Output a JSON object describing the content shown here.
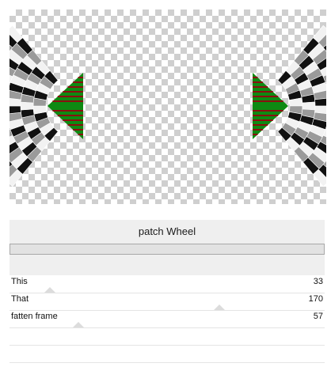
{
  "panel": {
    "title": "patch Wheel"
  },
  "sliders": [
    {
      "label": "This",
      "value": "33",
      "level": 0.13
    },
    {
      "label": "That",
      "value": "170",
      "level": 0.66
    },
    {
      "label": "fatten frame",
      "value": "57",
      "level": 0.22
    }
  ],
  "preview": {
    "colors": {
      "green": "#0e8a12",
      "red": "#8a1010",
      "dark": "#111111",
      "light": "#f2f2f2",
      "gray": "#9a9a9a"
    }
  }
}
